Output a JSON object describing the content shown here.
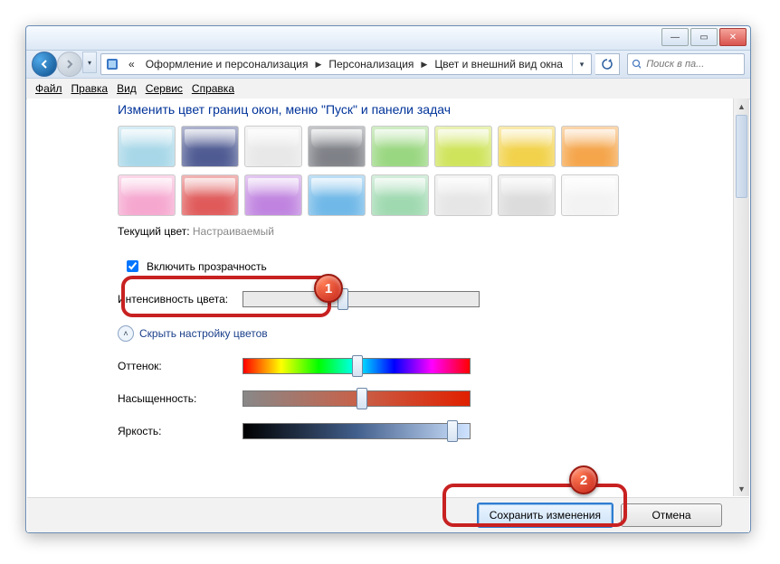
{
  "window": {
    "minimize": "—",
    "maximize": "▭",
    "close": "✕"
  },
  "breadcrumb": {
    "prefix": "«",
    "part1": "Оформление и персонализация",
    "part2": "Персонализация",
    "part3": "Цвет и внешний вид окна"
  },
  "search": {
    "placeholder": "Поиск в па..."
  },
  "menus": {
    "file": "Файл",
    "edit": "Правка",
    "view": "Вид",
    "tools": "Сервис",
    "help": "Справка"
  },
  "heading": "Изменить цвет границ окон, меню \"Пуск\" и панели задач",
  "swatches_row1": [
    "#a7d7e8",
    "#4e5a92",
    "#e8e8e8",
    "#7e8187",
    "#99d780",
    "#cfe45a",
    "#f2d24a",
    "#f5a54a"
  ],
  "swatches_row2": [
    "#f6a7cf",
    "#e05a5a",
    "#c084e0",
    "#6fb8e8",
    "#9fd9b0",
    "#e6e6e6",
    "#dcdcdc",
    "#f3f3f3"
  ],
  "current_color_label": "Текущий цвет:",
  "current_color_value": "Настраиваемый",
  "transparency_label": "Включить прозрачность",
  "intensity_label": "Интенсивность цвета:",
  "mixer_toggle": "Скрыть настройку цветов",
  "hue_label": "Оттенок:",
  "sat_label": "Насыщенность:",
  "bri_label": "Яркость:",
  "buttons": {
    "save": "Сохранить изменения",
    "cancel": "Отмена"
  },
  "steps": {
    "one": "1",
    "two": "2"
  },
  "slider_positions": {
    "intensity": 42,
    "hue": 50,
    "sat": 52,
    "bri": 92
  }
}
